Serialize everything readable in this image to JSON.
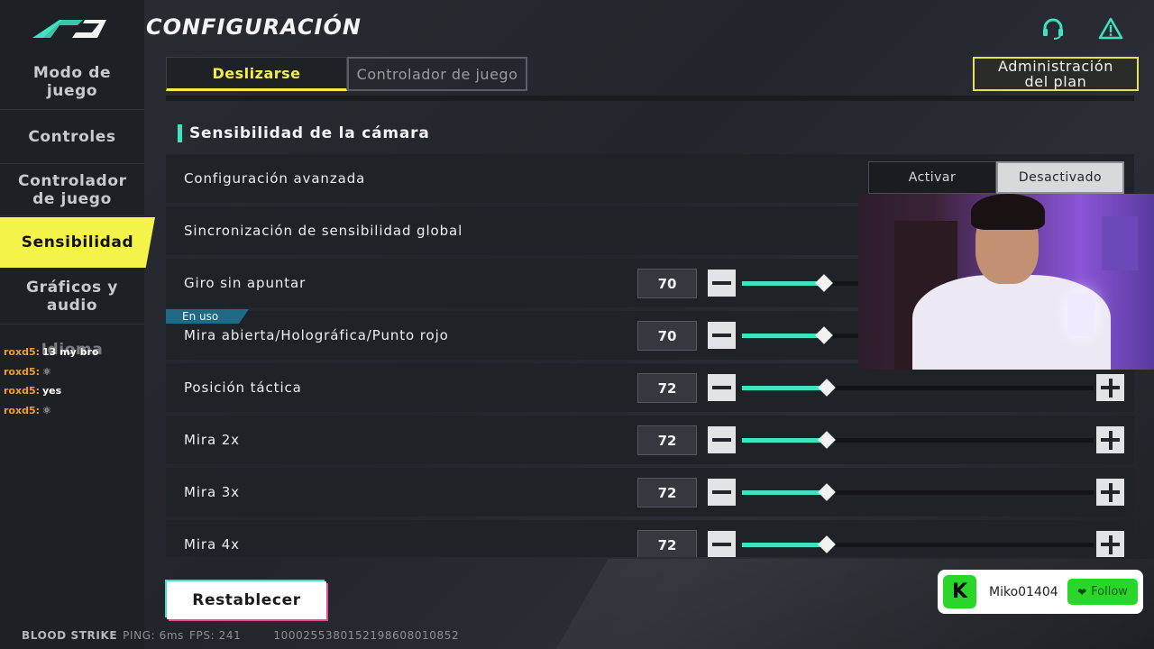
{
  "header": {
    "title": "CONFIGURACIÓN"
  },
  "sidebar": {
    "items": [
      {
        "label": "Modo de juego",
        "active": false
      },
      {
        "label": "Controles",
        "active": false
      },
      {
        "label": "Controlador de juego",
        "active": false
      },
      {
        "label": "Sensibilidad",
        "active": true
      },
      {
        "label": "Gráficos y audio",
        "active": false
      },
      {
        "label": "Idioma",
        "active": false
      }
    ]
  },
  "chat": [
    {
      "user": "roxd5:",
      "message": "13 my bro"
    },
    {
      "user": "roxd5:",
      "message": ""
    },
    {
      "user": "roxd5:",
      "message": "yes"
    },
    {
      "user": "roxd5:",
      "message": ""
    }
  ],
  "tabs": [
    {
      "label": "Deslizarse",
      "active": true
    },
    {
      "label": "Controlador de juego",
      "active": false
    }
  ],
  "plan_button": "Administración del plan",
  "section": {
    "title": "Sensibilidad de la cámara",
    "advanced": {
      "label": "Configuración avanzada",
      "option_on": "Activar",
      "option_off": "Desactivado",
      "selected": "Desactivado"
    },
    "sync_label": "Sincronización de sensibilidad global",
    "badge": "En uso",
    "sliders": [
      {
        "label": "Giro sin apuntar",
        "value": 70
      },
      {
        "label": "Mira abierta/Holográfica/Punto rojo",
        "value": 70
      },
      {
        "label": "Posición táctica",
        "value": 72
      },
      {
        "label": "Mira 2x",
        "value": 72
      },
      {
        "label": "Mira 3x",
        "value": 72
      },
      {
        "label": "Mira 4x",
        "value": 72
      }
    ],
    "slider_max": 300
  },
  "reset_button": "Restablecer",
  "footer": {
    "brand": "BLOOD STRIKE",
    "ping": "PING: 6ms",
    "fps": "FPS: 241",
    "uid": "1000255380152198608010852"
  },
  "follow": {
    "user": "Miko01404",
    "button": "Follow",
    "logo": "K"
  },
  "colors": {
    "accent_yellow": "#f4f34a",
    "accent_teal": "#3fe3c0",
    "kick_green": "#2bd62b"
  },
  "icons": {
    "support": "headset-icon",
    "alert": "warning-icon"
  }
}
